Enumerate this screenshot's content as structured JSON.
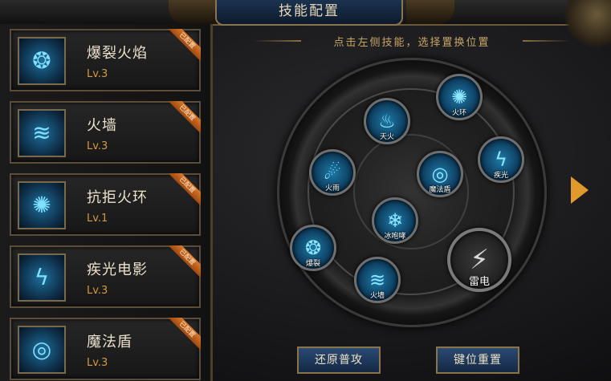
{
  "header": {
    "title": "技能配置"
  },
  "hint": "点击左侧技能，选择置换位置",
  "skills": [
    {
      "name": "爆裂火焰",
      "level": "Lv.3",
      "badge": "已配置",
      "icon": "flame-burst-icon",
      "glyph": "❂"
    },
    {
      "name": "火墙",
      "level": "Lv.3",
      "badge": "已配置",
      "icon": "fire-wall-icon",
      "glyph": "≋"
    },
    {
      "name": "抗拒火环",
      "level": "Lv.1",
      "badge": "已配置",
      "icon": "fire-ring-icon",
      "glyph": "✺"
    },
    {
      "name": "疾光电影",
      "level": "Lv.3",
      "badge": "已配置",
      "icon": "lightning-beam-icon",
      "glyph": "ϟ"
    },
    {
      "name": "魔法盾",
      "level": "Lv.3",
      "badge": "已配置",
      "icon": "magic-shield-icon",
      "glyph": "◎"
    }
  ],
  "wheel": [
    {
      "label": "天火",
      "icon": "sky-fire-icon",
      "glyph": "♨"
    },
    {
      "label": "火环",
      "icon": "fire-ring-icon",
      "glyph": "✺"
    },
    {
      "label": "火雨",
      "icon": "fire-rain-icon",
      "glyph": "☄"
    },
    {
      "label": "魔法盾",
      "icon": "magic-shield-icon",
      "glyph": "◎"
    },
    {
      "label": "疾光",
      "icon": "lightning-beam-icon",
      "glyph": "ϟ"
    },
    {
      "label": "冰咆哮",
      "icon": "ice-roar-icon",
      "glyph": "❄"
    },
    {
      "label": "爆裂",
      "icon": "flame-burst-icon",
      "glyph": "❂"
    },
    {
      "label": "火墙",
      "icon": "fire-wall-icon",
      "glyph": "≋"
    },
    {
      "label": "雷电",
      "icon": "thunder-icon",
      "glyph": "⚡"
    }
  ],
  "buttons": {
    "restore": "还原普攻",
    "reset": "键位重置"
  },
  "colors": {
    "accent": "#e09a2c",
    "level": "#d69a3c",
    "title": "#e7d9b8"
  }
}
